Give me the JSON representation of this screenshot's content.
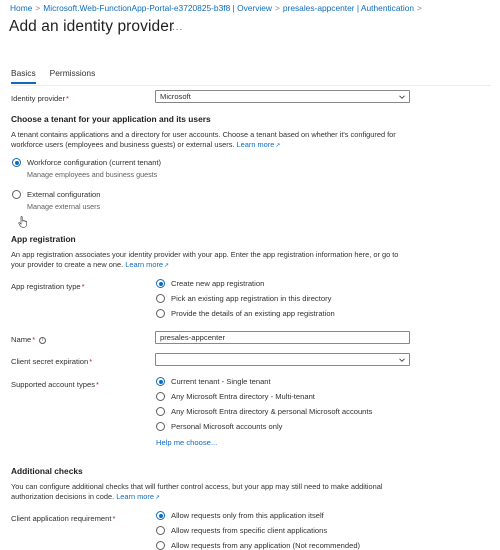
{
  "breadcrumb": {
    "home": "Home",
    "app": "Microsoft.Web-FunctionApp-Portal-e3720825-b3f8 | Overview",
    "current": "presales-appcenter | Authentication",
    "separator": ">"
  },
  "page": {
    "title": "Add an identity provider",
    "more": "..."
  },
  "tabs": [
    {
      "label": "Basics"
    },
    {
      "label": "Permissions"
    }
  ],
  "identity_provider": {
    "label": "Identity provider",
    "required": "*",
    "value": "Microsoft"
  },
  "tenant": {
    "title": "Choose a tenant for your application and its users",
    "description": "A tenant contains applications and a directory for user accounts. Choose a tenant based on whether it's configured for workforce users (employees and business guests) or external users.",
    "learn_more": "Learn more",
    "options": [
      {
        "label": "Workforce configuration (current tenant)",
        "sub": "Manage employees and business guests"
      },
      {
        "label": "External configuration",
        "sub": "Manage external users"
      }
    ]
  },
  "app_registration": {
    "title": "App registration",
    "description": "An app registration associates your identity provider with your app. Enter the app registration information here, or go to your provider to create a new one.",
    "learn_more": "Learn more",
    "type_label": "App registration type",
    "type_options": [
      "Create new app registration",
      "Pick an existing app registration in this directory",
      "Provide the details of an existing app registration"
    ],
    "name_label": "Name",
    "name_value": "presales-appcenter",
    "secret_label": "Client secret expiration",
    "secret_value": "",
    "account_types_label": "Supported account types",
    "account_types": [
      "Current tenant - Single tenant",
      "Any Microsoft Entra directory - Multi-tenant",
      "Any Microsoft Entra directory & personal Microsoft accounts",
      "Personal Microsoft accounts only"
    ],
    "help": "Help me choose..."
  },
  "additional_checks": {
    "title": "Additional checks",
    "description": "You can configure additional checks that will further control access, but your app may still need to make additional authorization decisions in code.",
    "learn_more": "Learn more",
    "client_req_label": "Client application requirement",
    "client_req_options": [
      "Allow requests only from this application itself",
      "Allow requests from specific client applications",
      "Allow requests from any application (Not recommended)"
    ]
  },
  "colors": {
    "accent": "#0f6cbd",
    "required": "#a4262c",
    "text": "#323130"
  }
}
